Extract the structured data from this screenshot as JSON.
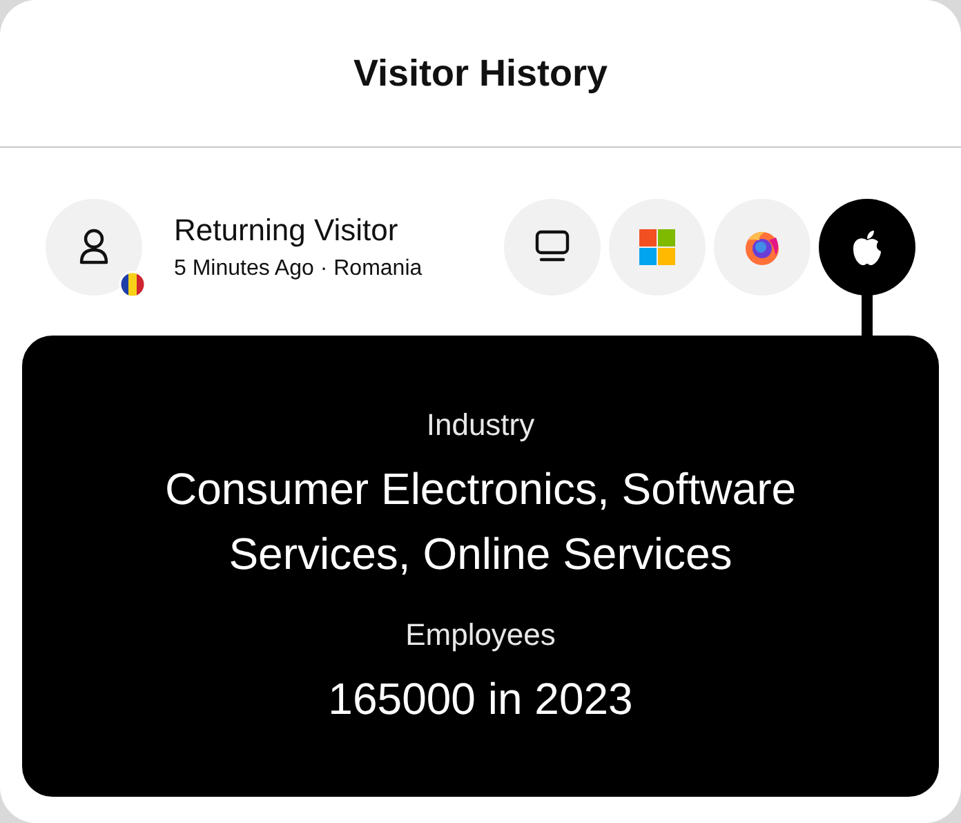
{
  "header": {
    "title": "Visitor History"
  },
  "visitor": {
    "name": "Returning Visitor",
    "meta": "5 Minutes Ago · Romania"
  },
  "devices": [
    {
      "kind": "desktop",
      "selected": false
    },
    {
      "kind": "windows",
      "selected": false
    },
    {
      "kind": "firefox",
      "selected": false
    },
    {
      "kind": "apple",
      "selected": true
    }
  ],
  "details": [
    {
      "label": "Industry",
      "value": "Consumer Electronics, Software Services, Online Services"
    },
    {
      "label": "Employees",
      "value": "165000 in 2023"
    }
  ]
}
